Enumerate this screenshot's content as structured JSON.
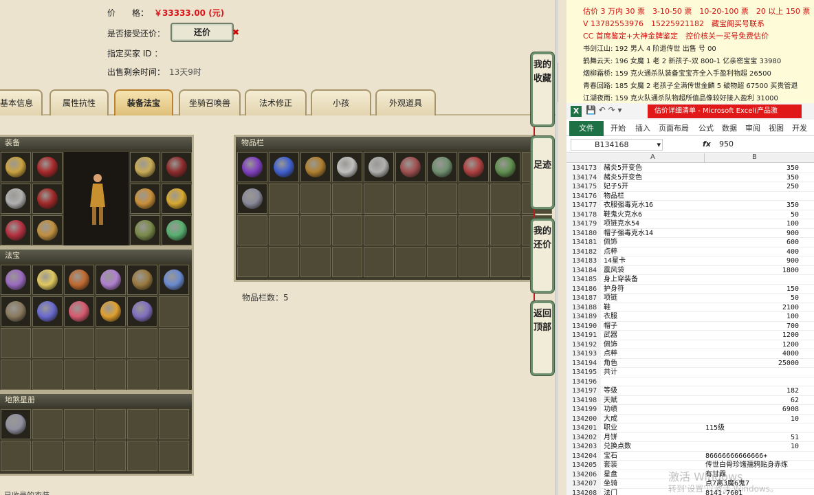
{
  "listing": {
    "price_label": "价　　格：",
    "price_value": "￥33333.00 (元)",
    "counter_label": "是否接受还价：",
    "counter_button": "还价",
    "counter_close": "✖",
    "buyer_label": "指定买家 ID ：",
    "time_label": "出售剩余时间：",
    "time_value": "13天9时"
  },
  "tabs": [
    {
      "label": "基本信息"
    },
    {
      "label": "属性抗性"
    },
    {
      "label": "装备法宝"
    },
    {
      "label": "坐骑召唤兽"
    },
    {
      "label": "法术修正"
    },
    {
      "label": "小孩"
    },
    {
      "label": "外观道具"
    }
  ],
  "panels": {
    "equip_title": "装备",
    "treasure_title": "法宝",
    "star_title": "地煞星册",
    "inventory_title": "物品栏",
    "inventory_count": "物品栏数：5",
    "bottom_title": "已收录的衣装"
  },
  "item_colors": {
    "equip": [
      "#c9a240",
      "#a8292b",
      "#c9ab55",
      "#8c2c2c",
      "#b0b0b0",
      "#a02828",
      "#c98f3a",
      "#d8a830",
      "#b43040",
      "#c09040",
      "#7a8a4a",
      "#58b070"
    ],
    "treasure": [
      "#9a6ac0",
      "#e0c860",
      "#c06a30",
      "#b080d0",
      "#9a7a40",
      "#6a8ad0",
      "#8a7a60",
      "#6a6ad0",
      "#d85a70",
      "#e0a030",
      "#8070c0"
    ],
    "inventory": [
      "#8040c0",
      "#4060d0",
      "#b08030",
      "#c0c0c0",
      "#b0b0b0",
      "#a05050",
      "#709070",
      "#b04040",
      "#609050",
      "#8a8a9a"
    ],
    "star": [
      "#9090a0"
    ]
  },
  "side_buttons": [
    {
      "label": "我的收藏"
    },
    {
      "label": "足迹"
    },
    {
      "label": "我的还价"
    },
    {
      "label": "返回顶部"
    }
  ],
  "chat": [
    {
      "text": "估价 3 万内 30 票　3-10-50 票　10-20-100 票　20 以上 150 票",
      "color": "#d01010"
    },
    {
      "text": "V 13782553976　15225921182　藏宝阁买号联系",
      "color": "#d01010"
    },
    {
      "text": "CC 首席鉴定+大神金牌鉴定　控价核关一买号免费估价",
      "color": "#d01010"
    },
    {
      "text": "书剑江山: 192 男人 4 阶退传世 出售 号 00",
      "color": "#222"
    },
    {
      "text": "鹤舞云天: 196 女魔 1 老 2 新孩子-双 800-1 亿亲密宝宝 33980",
      "color": "#222"
    },
    {
      "text": "烟柳霜桥: 159 克火通杀队装备宝宝齐全入手盈利物超 26500",
      "color": "#222"
    },
    {
      "text": "青春回路: 185 女魔 2 老孩子全满传世金麟 5 破物超 67500 买贵管退",
      "color": "#222"
    },
    {
      "text": "江湖夜雨: 159 克火队通杀队物超所值品像较好接入盈利 31000",
      "color": "#222"
    }
  ],
  "excel": {
    "title": "估价详细清单 - Microsoft Excel(产品激",
    "menu": [
      "文件",
      "开始",
      "插入",
      "页面布局",
      "公式",
      "数据",
      "审阅",
      "视图",
      "开发工"
    ],
    "name_box": "B134168",
    "fx": "fx",
    "formula_value": "950",
    "col_a": "A",
    "col_b": "B",
    "rows": [
      {
        "n": "134173",
        "a": "赭炎5开变色",
        "b": "350"
      },
      {
        "n": "134174",
        "a": "赭炎5开变色",
        "b": "350"
      },
      {
        "n": "134175",
        "a": "妃子5开",
        "b": "250"
      },
      {
        "n": "134176",
        "a": "物品栏",
        "b": ""
      },
      {
        "n": "134177",
        "a": "衣服强毒克水16",
        "b": "350"
      },
      {
        "n": "134178",
        "a": "鞋鬼火克水6",
        "b": "50"
      },
      {
        "n": "134179",
        "a": "项链克水54",
        "b": "100"
      },
      {
        "n": "134180",
        "a": "帽子强毒克水14",
        "b": "900"
      },
      {
        "n": "134181",
        "a": "佩饰",
        "b": "600"
      },
      {
        "n": "134182",
        "a": "点粹",
        "b": "400"
      },
      {
        "n": "134183",
        "a": "14星卡",
        "b": "900"
      },
      {
        "n": "134184",
        "a": "震风袋",
        "b": "1800"
      },
      {
        "n": "134185",
        "a": "身上穿装备",
        "b": ""
      },
      {
        "n": "134186",
        "a": "护身符",
        "b": "150"
      },
      {
        "n": "134187",
        "a": "项链",
        "b": "50"
      },
      {
        "n": "134188",
        "a": "鞋",
        "b": "2100"
      },
      {
        "n": "134189",
        "a": "衣服",
        "b": "100"
      },
      {
        "n": "134190",
        "a": "帽子",
        "b": "700"
      },
      {
        "n": "134191",
        "a": "武器",
        "b": "1200"
      },
      {
        "n": "134192",
        "a": "佩饰",
        "b": "1200"
      },
      {
        "n": "134193",
        "a": "点粹",
        "b": "4000"
      },
      {
        "n": "134194",
        "a": "角色",
        "b": "25000"
      },
      {
        "n": "134195",
        "a": "共计",
        "b": ""
      },
      {
        "n": "134196",
        "a": "",
        "b": ""
      },
      {
        "n": "134197",
        "a": "等级",
        "b": "182"
      },
      {
        "n": "134198",
        "a": "天赋",
        "b": "62"
      },
      {
        "n": "134199",
        "a": "功绩",
        "b": "6908"
      },
      {
        "n": "134200",
        "a": "大成",
        "b": "10"
      },
      {
        "n": "134201",
        "a": "职业",
        "b": "115级"
      },
      {
        "n": "134202",
        "a": "月饼",
        "b": "51"
      },
      {
        "n": "134203",
        "a": "兑换点数",
        "b": "10"
      },
      {
        "n": "134204",
        "a": "宝石",
        "b": "86666666666666+"
      },
      {
        "n": "134205",
        "a": "套装",
        "b": "传世白骨珍馐孺鸦贴身赤炼"
      },
      {
        "n": "134206",
        "a": "星盘",
        "b": "有甘霖"
      },
      {
        "n": "134207",
        "a": "坐骑",
        "b": "点7离3魔6鬼7"
      },
      {
        "n": "134208",
        "a": "法门",
        "b": "8141-7601"
      }
    ],
    "watermark": "激活 Windows",
    "watermark_sub": "转到'设置'以激活 Windows。"
  }
}
